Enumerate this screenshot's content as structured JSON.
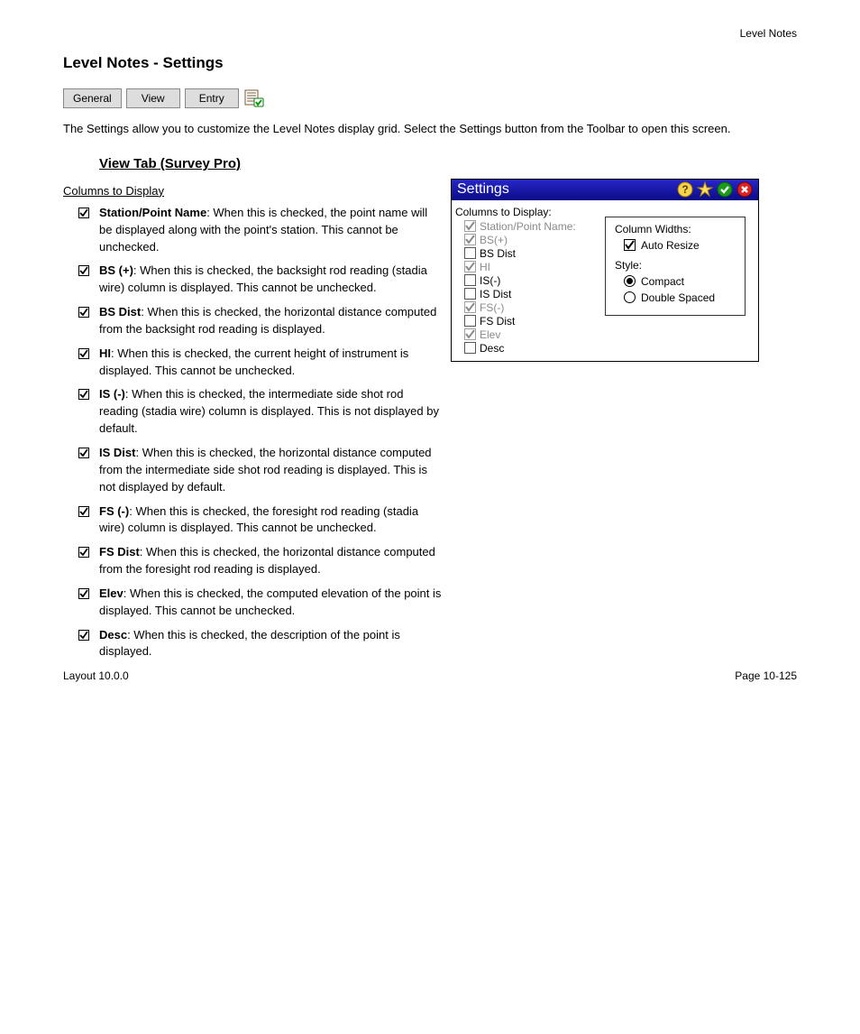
{
  "page": {
    "header_right": "Level Notes",
    "title": "Level Notes - Settings",
    "footer_left": "Layout 10.0.0",
    "footer_right": "Page 10-125"
  },
  "toolbar": {
    "tabs": [
      "General",
      "View",
      "Entry"
    ],
    "icon_name": "settings-ok-icon"
  },
  "intro": "The Settings allow you to customize the Level Notes display grid. Select the Settings button from the Toolbar to open this screen.",
  "view_header": "View Tab (Survey Pro)",
  "columns_header": "Columns to Display",
  "items": [
    {
      "label": "Station/Point Name",
      "desc": ": When this is checked, the point name will be displayed along with the point's station. This cannot be unchecked."
    },
    {
      "label": "BS (+)",
      "desc": ": When this is checked, the backsight rod reading (stadia wire) column is displayed. This cannot be unchecked."
    },
    {
      "label": "BS Dist",
      "desc": ": When this is checked, the horizontal distance computed from the backsight rod reading is displayed."
    },
    {
      "label": "HI",
      "desc": ": When this is checked, the current height of instrument is displayed. This cannot be unchecked."
    },
    {
      "label": "IS (-)",
      "desc": ": When this is checked, the intermediate side shot rod reading (stadia wire) column is displayed. This is not displayed by default."
    },
    {
      "label": "IS Dist",
      "desc": ": When this is checked, the horizontal distance computed from the intermediate side shot rod reading is displayed. This is not displayed by default."
    },
    {
      "label": "FS (-)",
      "desc": ": When this is checked, the foresight rod reading (stadia wire) column is displayed. This cannot be unchecked."
    },
    {
      "label": "FS Dist",
      "desc": ": When this is checked, the horizontal distance computed from the foresight rod reading is displayed."
    },
    {
      "label": "Elev",
      "desc": ": When this is checked, the computed elevation of the point is displayed. This cannot be unchecked."
    },
    {
      "label": "Desc",
      "desc": ": When this is checked, the description of the point is displayed."
    }
  ],
  "checked": [
    true,
    true,
    true,
    true,
    true,
    true,
    true,
    true,
    true,
    true
  ],
  "dlg": {
    "title": "Settings",
    "columns_label": "Columns to Display:",
    "columns": [
      {
        "label": "Station/Point Name:",
        "checked": true,
        "disabled": true
      },
      {
        "label": "BS(+)",
        "checked": true,
        "disabled": true
      },
      {
        "label": "BS Dist",
        "checked": false,
        "disabled": false
      },
      {
        "label": "HI",
        "checked": true,
        "disabled": true
      },
      {
        "label": "IS(-)",
        "checked": false,
        "disabled": false
      },
      {
        "label": "IS Dist",
        "checked": false,
        "disabled": false
      },
      {
        "label": "FS(-)",
        "checked": true,
        "disabled": true
      },
      {
        "label": "FS Dist",
        "checked": false,
        "disabled": false
      },
      {
        "label": "Elev",
        "checked": true,
        "disabled": true
      },
      {
        "label": "Desc",
        "checked": false,
        "disabled": false
      }
    ],
    "column_widths_label": "Column Widths:",
    "auto_resize_label": "Auto Resize",
    "auto_resize_checked": true,
    "style_label": "Style:",
    "style_options": [
      "Compact",
      "Double Spaced"
    ],
    "style_selected": 0
  }
}
